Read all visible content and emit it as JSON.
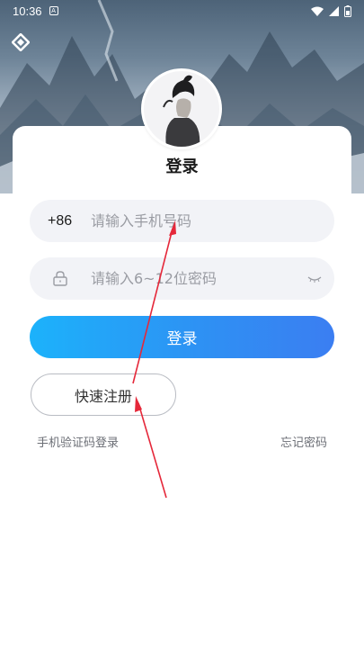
{
  "status_bar": {
    "time": "10:36",
    "notification_icon": "A",
    "icons": [
      "wifi-icon",
      "signal-icon",
      "battery-icon"
    ]
  },
  "colors": {
    "accent_start": "#1cb2fb",
    "accent_end": "#3b7ef2",
    "field_bg": "#f2f3f7",
    "placeholder": "#9a9ca3",
    "annotation_arrow": "#e5283a"
  },
  "login": {
    "title": "登录",
    "country_code": "+86",
    "phone_placeholder": "请输入手机号码",
    "password_placeholder": "请输入6~12位密码",
    "login_button": "登录",
    "register_button": "快速注册",
    "sms_login_link": "手机验证码登录",
    "forgot_password_link": "忘记密码"
  }
}
